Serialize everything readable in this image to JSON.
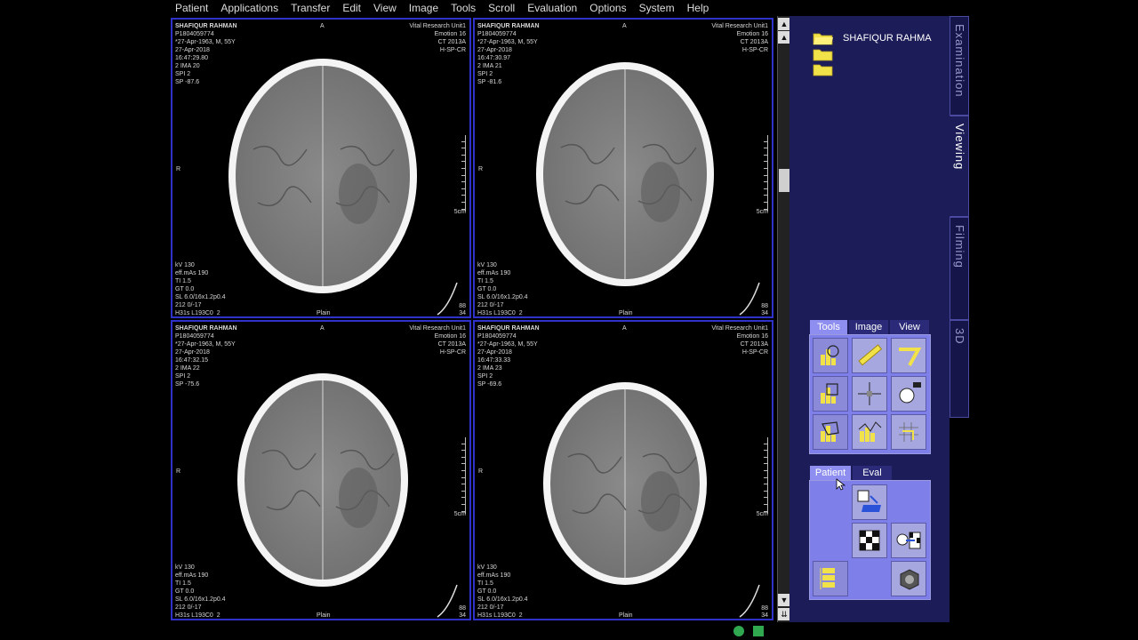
{
  "menu": [
    "Patient",
    "Applications",
    "Transfer",
    "Edit",
    "View",
    "Image",
    "Tools",
    "Scroll",
    "Evaluation",
    "Options",
    "System",
    "Help"
  ],
  "viewports": [
    {
      "patient": "SHAFIQUR RAHMAN",
      "id": "P1804059774",
      "dob": "*27-Apr-1963, M, 55Y",
      "date": "27-Apr-2018",
      "time": "16:47:29.80",
      "ima": "2 IMA 20",
      "spi": "SPI 2",
      "sp": "SP -87.6",
      "inst": "Vital Research Unit1",
      "model": "Emotion 16",
      "ct": "CT 2013A",
      "hsp": "H-SP-CR",
      "tech": [
        "kV 130",
        "eff.mAs 190",
        "TI 1.5",
        "GT 0.0",
        "SL 6.0/16x1.2p0.4",
        "212 0/-17",
        "H31s L193C0  2"
      ],
      "orient_top": "A",
      "orient_left": "R",
      "scale": "5cm",
      "kernel": "Plain",
      "pg1": "88",
      "pg2": "34"
    },
    {
      "patient": "SHAFIQUR RAHMAN",
      "id": "P1804059774",
      "dob": "*27-Apr-1963, M, 55Y",
      "date": "27-Apr-2018",
      "time": "16:47:30.97",
      "ima": "2 IMA 21",
      "spi": "SPI 2",
      "sp": "SP -81.6",
      "inst": "Vital Research Unit1",
      "model": "Emotion 16",
      "ct": "CT 2013A",
      "hsp": "H-SP-CR",
      "tech": [
        "kV 130",
        "eff.mAs 190",
        "TI 1.5",
        "GT 0.0",
        "SL 6.0/16x1.2p0.4",
        "212 0/-17",
        "H31s L193C0  2"
      ],
      "orient_top": "A",
      "orient_left": "R",
      "scale": "5cm",
      "kernel": "Plain",
      "pg1": "88",
      "pg2": "34"
    },
    {
      "patient": "SHAFIQUR RAHMAN",
      "id": "P1804059774",
      "dob": "*27-Apr-1963, M, 55Y",
      "date": "27-Apr-2018",
      "time": "16:47:32.15",
      "ima": "2 IMA 22",
      "spi": "SPI 2",
      "sp": "SP -75.6",
      "inst": "Vital Research Unit1",
      "model": "Emotion 16",
      "ct": "CT 2013A",
      "hsp": "H-SP-CR",
      "tech": [
        "kV 130",
        "eff.mAs 190",
        "TI 1.5",
        "GT 0.0",
        "SL 6.0/16x1.2p0.4",
        "212 0/-17",
        "H31s L193C0  2"
      ],
      "orient_top": "A",
      "orient_left": "R",
      "scale": "5cm",
      "kernel": "Plain",
      "pg1": "88",
      "pg2": "34"
    },
    {
      "patient": "SHAFIQUR RAHMAN",
      "id": "P1804059774",
      "dob": "*27-Apr-1963, M, 55Y",
      "date": "27-Apr-2018",
      "time": "16:47:33.33",
      "ima": "2 IMA 23",
      "spi": "SPI 2",
      "sp": "SP -69.6",
      "inst": "Vital Research Unit1",
      "model": "Emotion 16",
      "ct": "CT 2013A",
      "hsp": "H-SP-CR",
      "tech": [
        "kV 130",
        "eff.mAs 190",
        "TI 1.5",
        "GT 0.0",
        "SL 6.0/16x1.2p0.4",
        "212 0/-17",
        "H31s L193C0  2"
      ],
      "orient_top": "A",
      "orient_left": "R",
      "scale": "5cm",
      "kernel": "Plain",
      "pg1": "88",
      "pg2": "34"
    }
  ],
  "side_tabs": [
    "Examination",
    "Viewing",
    "Filming",
    "3D"
  ],
  "patient_folder": "SHAFIQUR RAHMA",
  "tool_tabs": [
    "Tools",
    "Image",
    "View"
  ],
  "patient_tabs": [
    "Patient",
    "Eval"
  ],
  "icons": {
    "scroll_up": "▲",
    "scroll_down": "▼",
    "scroll_end": "⇊"
  },
  "colors": {
    "panel": "#1c1c58",
    "toolgroup": "#7f7fe9",
    "viewport_border": "#2f32c8",
    "folder": "#f2e24a"
  }
}
